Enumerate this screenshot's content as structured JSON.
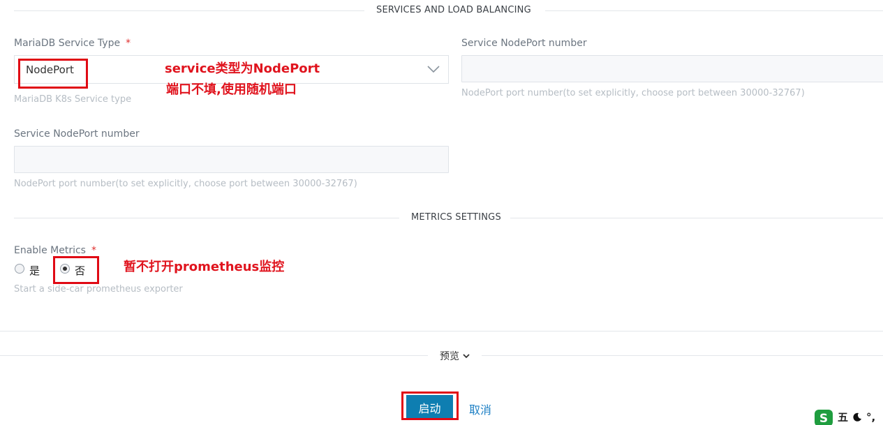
{
  "sections": {
    "services": "SERVICES AND LOAD BALANCING",
    "metrics": "METRICS SETTINGS"
  },
  "service_type": {
    "label": "MariaDB Service Type",
    "required_mark": "*",
    "value": "NodePort",
    "help": "MariaDB K8s Service type"
  },
  "nodeport_right": {
    "label": "Service NodePort number",
    "value": "",
    "help": "NodePort port number(to set explicitly, choose port between 30000-32767)"
  },
  "nodeport_left": {
    "label": "Service NodePort number",
    "value": "",
    "help": "NodePort port number(to set explicitly, choose port between 30000-32767)"
  },
  "metrics": {
    "label": "Enable Metrics",
    "required_mark": "*",
    "option_yes": "是",
    "option_no": "否",
    "selected": "否",
    "help": "Start a side-car prometheus exporter"
  },
  "annotations": {
    "service_line1": "service类型为NodePort",
    "service_line2": "端口不填,使用随机端口",
    "metrics_note": "暂不打开prometheus监控"
  },
  "preview_label": "预览",
  "buttons": {
    "launch": "启动",
    "cancel": "取消"
  },
  "ime": {
    "mode": "五",
    "punct": "°,"
  },
  "colors": {
    "primary": "#0e7eb1",
    "annotation": "#e00a14",
    "required": "#e0302f"
  }
}
